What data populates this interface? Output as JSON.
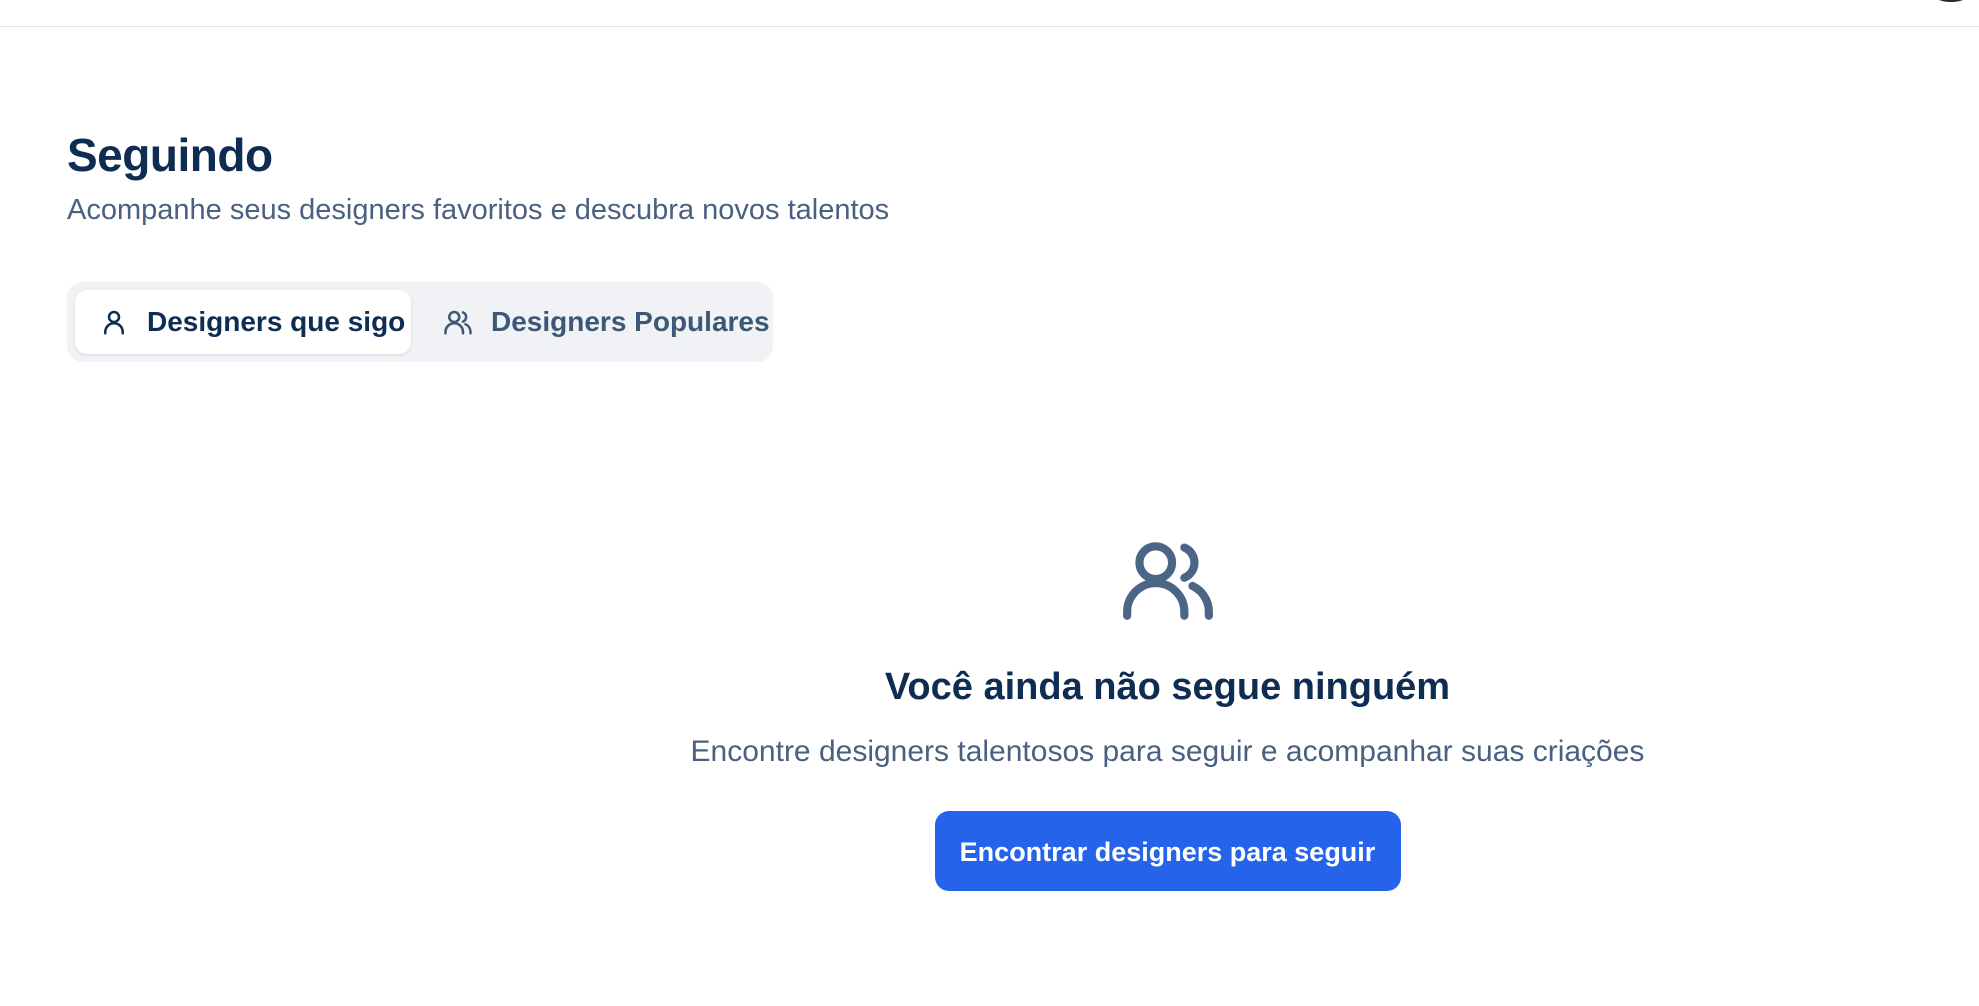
{
  "header": {
    "title": "Seguindo",
    "subtitle": "Acompanhe seus designers favoritos e descubra novos talentos"
  },
  "tabs": [
    {
      "label": "Designers que sigo",
      "icon": "user-icon",
      "active": true
    },
    {
      "label": "Designers Populares",
      "icon": "users-icon",
      "active": false
    }
  ],
  "empty_state": {
    "icon": "users-icon",
    "title": "Você ainda não segue ninguém",
    "description": "Encontre designers talentosos para seguir e acompanhar suas criações",
    "button_label": "Encontrar designers para seguir"
  },
  "colors": {
    "primary": "#2563eb",
    "heading": "#0f2d52",
    "muted": "#4a6080",
    "tab_bg": "#f0f2f5"
  }
}
